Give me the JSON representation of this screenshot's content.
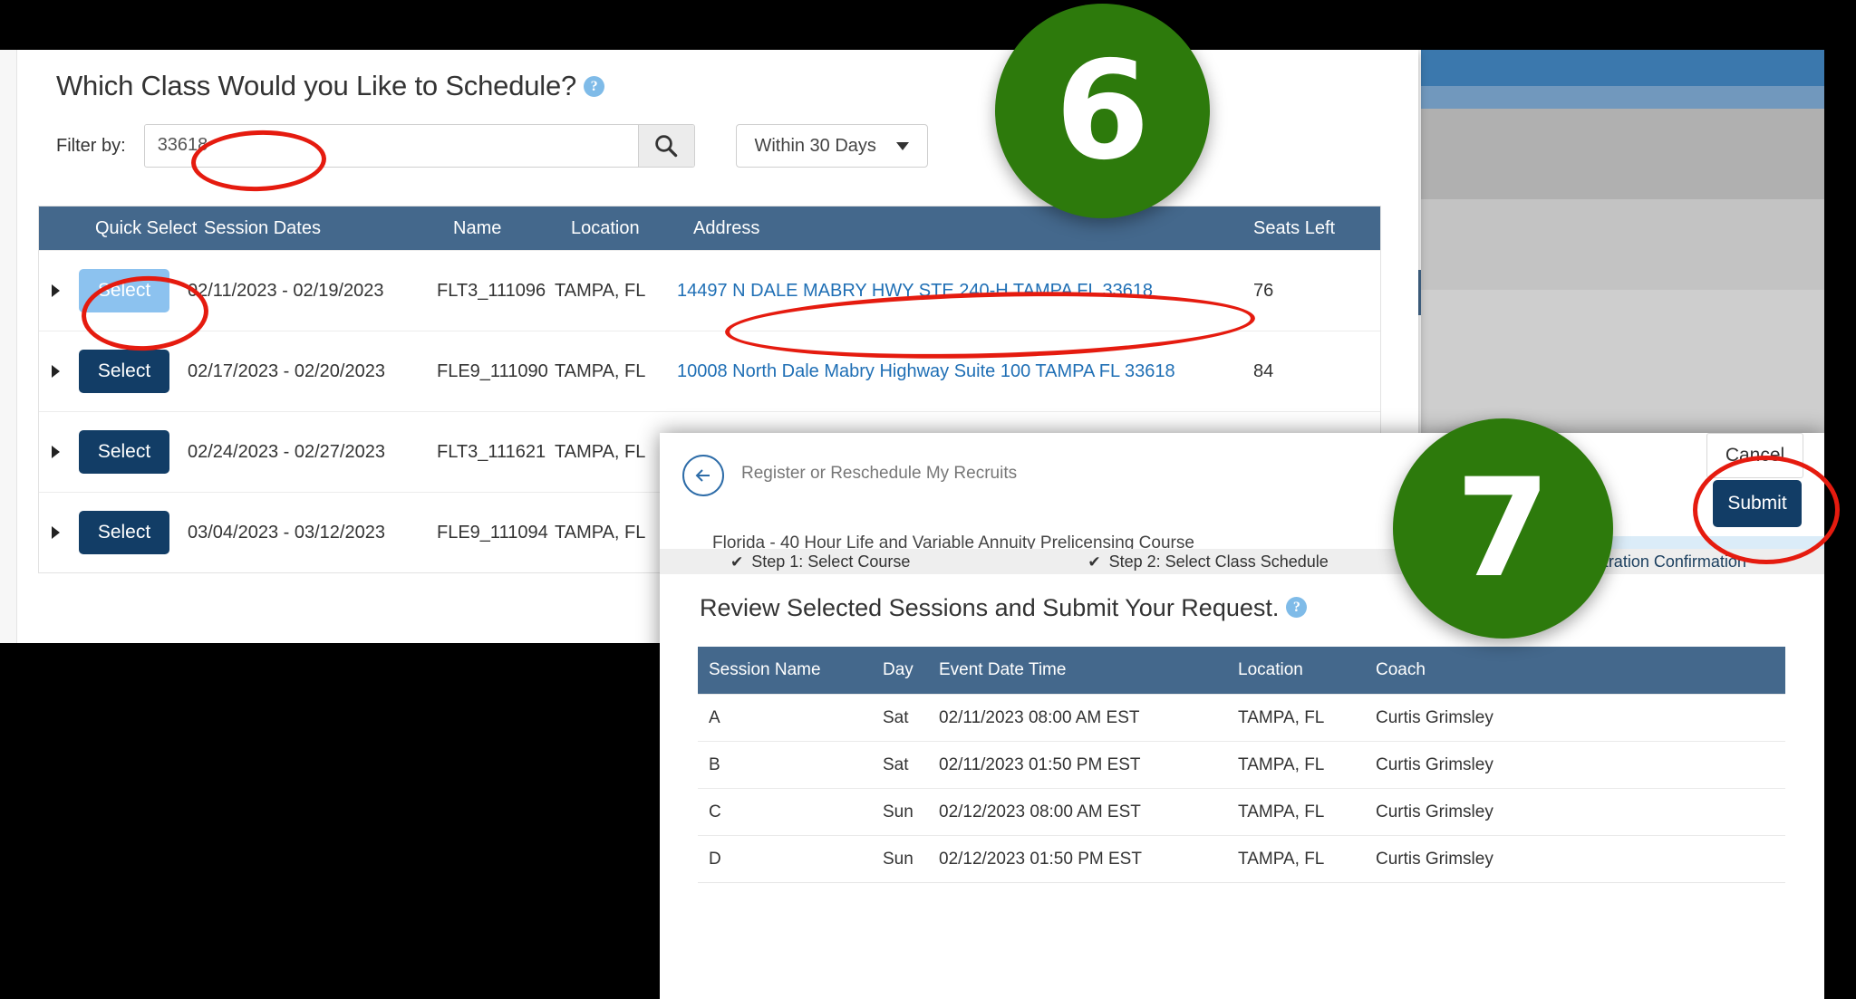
{
  "class_schedule": {
    "title": "Which Class Would you Like to Schedule?",
    "help_icon": "?",
    "filter_label": "Filter by:",
    "filter_value": "33618",
    "filter_placeholder": "",
    "search_icon": "search-icon",
    "date_range": "Within 30 Days",
    "columns": {
      "expand": "",
      "quick_select": "Quick Select",
      "session_dates": "Session Dates",
      "name": "Name",
      "location": "Location",
      "address": "Address",
      "seats_left": "Seats Left"
    },
    "rows": [
      {
        "select_label": "Select",
        "session_dates": "02/11/2023 - 02/19/2023",
        "name": "FLT3_111096",
        "location": "TAMPA, FL",
        "address": "14497 N DALE MABRY HWY STE 240-H TAMPA FL 33618",
        "seats_left": "76",
        "highlighted": true
      },
      {
        "select_label": "Select",
        "session_dates": "02/17/2023 - 02/20/2023",
        "name": "FLE9_111090",
        "location": "TAMPA, FL",
        "address": "10008 North Dale Mabry Highway Suite 100 TAMPA FL 33618",
        "seats_left": "84",
        "highlighted": false
      },
      {
        "select_label": "Select",
        "session_dates": "02/24/2023 - 02/27/2023",
        "name": "FLT3_111621",
        "location": "TAMPA, FL",
        "address": "",
        "seats_left": "",
        "highlighted": false
      },
      {
        "select_label": "Select",
        "session_dates": "03/04/2023 - 03/12/2023",
        "name": "FLE9_111094",
        "location": "TAMPA, FL",
        "address": "",
        "seats_left": "",
        "highlighted": false
      }
    ]
  },
  "review_modal": {
    "back_icon": "back-arrow-icon",
    "breadcrumb": "Register or Reschedule My Recruits",
    "cancel_label": "Cancel",
    "submit_label": "Submit",
    "course_title": "Florida - 40 Hour Life and Variable Annuity Prelicensing Course",
    "check_mark": "✔",
    "step1": "Step 1: Select Course",
    "step2": "Step 2: Select Class Schedule",
    "step3": "Step 3: Registration Confirmation",
    "title": "Review Selected Sessions and Submit Your Request.",
    "help_icon": "?",
    "columns": {
      "session_name": "Session Name",
      "day": "Day",
      "event_date_time": "Event Date Time",
      "location": "Location",
      "coach": "Coach"
    },
    "rows": [
      {
        "session_name": "A",
        "day": "Sat",
        "event_date_time": "02/11/2023 08:00 AM EST",
        "location": "TAMPA, FL",
        "coach": "Curtis Grimsley"
      },
      {
        "session_name": "B",
        "day": "Sat",
        "event_date_time": "02/11/2023 01:50 PM EST",
        "location": "TAMPA, FL",
        "coach": "Curtis Grimsley"
      },
      {
        "session_name": "C",
        "day": "Sun",
        "event_date_time": "02/12/2023 08:00 AM EST",
        "location": "TAMPA, FL",
        "coach": "Curtis Grimsley"
      },
      {
        "session_name": "D",
        "day": "Sun",
        "event_date_time": "02/12/2023 01:50 PM EST",
        "location": "TAMPA, FL",
        "coach": "Curtis Grimsley"
      }
    ]
  },
  "annotations": {
    "badge_6": "6",
    "badge_7": "7",
    "badge_color": "#2d7a0c",
    "highlight_color": "#e51b0f"
  },
  "colors": {
    "table_header": "#44688c",
    "primary_button": "#123d66",
    "link": "#1f6fb5",
    "selected_button": "#8cc2ef",
    "step_highlight": "#8ec2ec"
  }
}
